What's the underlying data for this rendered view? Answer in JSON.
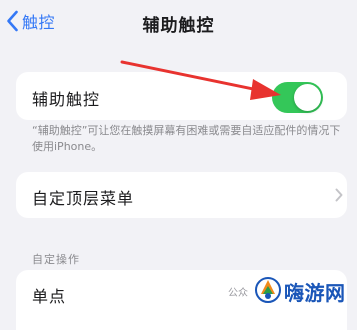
{
  "nav": {
    "back_label": "触控",
    "title": "辅助触控",
    "back_icon": "chevron-left-icon"
  },
  "assistive_touch": {
    "label": "辅助触控",
    "enabled": true,
    "toggle_color": "#34c759",
    "footnote": "“辅助触控”可让您在触摸屏幕有困难或需要自适应配件的情况下使用iPhone。"
  },
  "top_level_menu": {
    "label": "自定顶层菜单",
    "icon": "chevron-right-icon"
  },
  "custom_actions": {
    "header": "自定操作",
    "single_tap_label": "单点"
  },
  "watermark": {
    "small_text": "公众",
    "brand_text": "嗨游网"
  },
  "annotation": {
    "arrow_color": "#e8332f"
  },
  "colors": {
    "accent": "#3478f6",
    "background": "#f2f2f6"
  }
}
